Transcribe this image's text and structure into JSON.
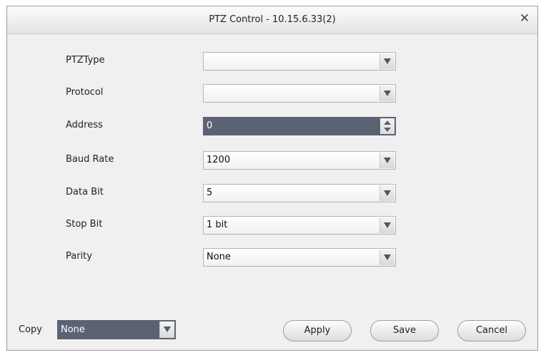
{
  "dialog": {
    "title": "PTZ Control - 10.15.6.33(2)",
    "close_glyph": "✕"
  },
  "fields": {
    "ptz_type": {
      "label": "PTZType",
      "value": ""
    },
    "protocol": {
      "label": "Protocol",
      "value": ""
    },
    "address": {
      "label": "Address",
      "value": "0"
    },
    "baud_rate": {
      "label": "Baud Rate",
      "value": "1200"
    },
    "data_bit": {
      "label": "Data Bit",
      "value": "5"
    },
    "stop_bit": {
      "label": "Stop Bit",
      "value": "1 bit"
    },
    "parity": {
      "label": "Parity",
      "value": "None"
    }
  },
  "footer": {
    "copy_label": "Copy",
    "copy_value": "None",
    "apply_label": "Apply",
    "save_label": "Save",
    "cancel_label": "Cancel"
  },
  "colors": {
    "selected_field": "#5b6273",
    "dialog_bg": "#f0f0f0"
  },
  "icons": {
    "close": "close-icon",
    "dropdown": "chevron-down-icon",
    "spinner": "spinner-arrows-icon"
  }
}
